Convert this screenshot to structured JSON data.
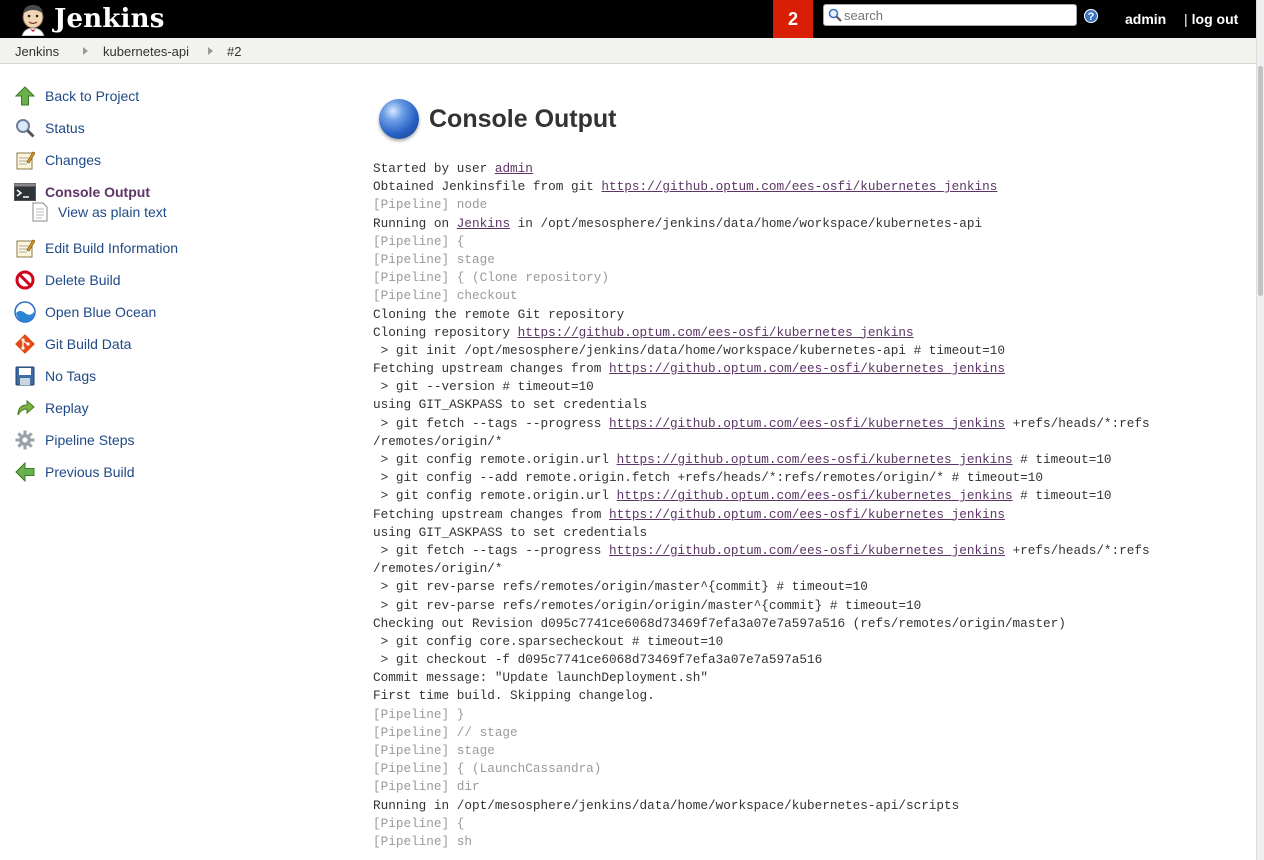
{
  "header": {
    "logo_text": "Jenkins",
    "notification_count": "2",
    "search_placeholder": "search",
    "user": "admin",
    "logout": "log out"
  },
  "breadcrumbs": [
    "Jenkins",
    "kubernetes-api",
    "#2"
  ],
  "side_panel": {
    "items": [
      {
        "label": "Back to Project",
        "icon": "up-arrow-icon"
      },
      {
        "label": "Status",
        "icon": "magnifier-icon"
      },
      {
        "label": "Changes",
        "icon": "notepad-icon"
      },
      {
        "label": "Console Output",
        "icon": "terminal-icon",
        "active": true
      },
      {
        "label": "View as plain text",
        "icon": "document-icon",
        "sub": true
      },
      {
        "label": "Edit Build Information",
        "icon": "notepad-icon"
      },
      {
        "label": "Delete Build",
        "icon": "no-entry-icon"
      },
      {
        "label": "Open Blue Ocean",
        "icon": "blue-ocean-icon"
      },
      {
        "label": "Git Build Data",
        "icon": "git-icon"
      },
      {
        "label": "No Tags",
        "icon": "save-icon"
      },
      {
        "label": "Replay",
        "icon": "replay-arrow-icon"
      },
      {
        "label": "Pipeline Steps",
        "icon": "gear-icon"
      },
      {
        "label": "Previous Build",
        "icon": "left-arrow-icon"
      }
    ]
  },
  "main": {
    "title": "Console Output",
    "console_lines": [
      [
        "Started by user ",
        {
          "link": "admin"
        }
      ],
      [
        "Obtained Jenkinsfile from git ",
        {
          "link": "https://github.optum.com/ees-osfi/kubernetes_jenkins"
        }
      ],
      [
        {
          "pipe": "[Pipeline] node"
        }
      ],
      [
        "Running on ",
        {
          "link": "Jenkins"
        },
        " in /opt/mesosphere/jenkins/data/home/workspace/kubernetes-api"
      ],
      [
        {
          "pipe": "[Pipeline] {"
        }
      ],
      [
        {
          "pipe": "[Pipeline] stage"
        }
      ],
      [
        {
          "pipe": "[Pipeline] { (Clone repository)"
        }
      ],
      [
        {
          "pipe": "[Pipeline] checkout"
        }
      ],
      [
        "Cloning the remote Git repository"
      ],
      [
        "Cloning repository ",
        {
          "link": "https://github.optum.com/ees-osfi/kubernetes_jenkins"
        }
      ],
      [
        " > git init /opt/mesosphere/jenkins/data/home/workspace/kubernetes-api # timeout=10"
      ],
      [
        "Fetching upstream changes from ",
        {
          "link": "https://github.optum.com/ees-osfi/kubernetes_jenkins"
        }
      ],
      [
        " > git --version # timeout=10"
      ],
      [
        "using GIT_ASKPASS to set credentials"
      ],
      [
        " > git fetch --tags --progress ",
        {
          "link": "https://github.optum.com/ees-osfi/kubernetes_jenkins"
        },
        " +refs/heads/*:refs"
      ],
      [
        "/remotes/origin/*"
      ],
      [
        " > git config remote.origin.url ",
        {
          "link": "https://github.optum.com/ees-osfi/kubernetes_jenkins"
        },
        " # timeout=10"
      ],
      [
        " > git config --add remote.origin.fetch +refs/heads/*:refs/remotes/origin/* # timeout=10"
      ],
      [
        " > git config remote.origin.url ",
        {
          "link": "https://github.optum.com/ees-osfi/kubernetes_jenkins"
        },
        " # timeout=10"
      ],
      [
        "Fetching upstream changes from ",
        {
          "link": "https://github.optum.com/ees-osfi/kubernetes_jenkins"
        }
      ],
      [
        "using GIT_ASKPASS to set credentials"
      ],
      [
        " > git fetch --tags --progress ",
        {
          "link": "https://github.optum.com/ees-osfi/kubernetes_jenkins"
        },
        " +refs/heads/*:refs"
      ],
      [
        "/remotes/origin/*"
      ],
      [
        " > git rev-parse refs/remotes/origin/master^{commit} # timeout=10"
      ],
      [
        " > git rev-parse refs/remotes/origin/origin/master^{commit} # timeout=10"
      ],
      [
        "Checking out Revision d095c7741ce6068d73469f7efa3a07e7a597a516 (refs/remotes/origin/master)"
      ],
      [
        " > git config core.sparsecheckout # timeout=10"
      ],
      [
        " > git checkout -f d095c7741ce6068d73469f7efa3a07e7a597a516"
      ],
      [
        "Commit message: \"Update launchDeployment.sh\""
      ],
      [
        "First time build. Skipping changelog."
      ],
      [
        {
          "pipe": "[Pipeline] }"
        }
      ],
      [
        {
          "pipe": "[Pipeline] // stage"
        }
      ],
      [
        {
          "pipe": "[Pipeline] stage"
        }
      ],
      [
        {
          "pipe": "[Pipeline] { (LaunchCassandra)"
        }
      ],
      [
        {
          "pipe": "[Pipeline] dir"
        }
      ],
      [
        "Running in /opt/mesosphere/jenkins/data/home/workspace/kubernetes-api/scripts"
      ],
      [
        {
          "pipe": "[Pipeline] {"
        }
      ],
      [
        {
          "pipe": "[Pipeline] sh"
        }
      ]
    ]
  },
  "colors": {
    "header_bg": "#000000",
    "notification_bg": "#d81e05",
    "link": "#204a87",
    "visited_link": "#5c3566",
    "pipeline_text": "#9a9a9a"
  }
}
